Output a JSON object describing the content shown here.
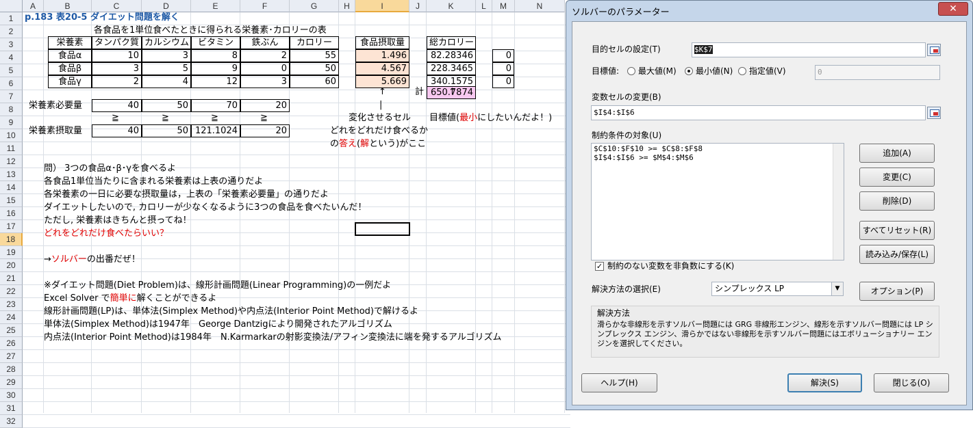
{
  "sheet": {
    "columns": [
      "A",
      "B",
      "C",
      "D",
      "E",
      "F",
      "G",
      "H",
      "I",
      "J",
      "K",
      "L",
      "M",
      "N"
    ],
    "rows": [
      "1",
      "2",
      "3",
      "4",
      "5",
      "6",
      "7",
      "8",
      "9",
      "10",
      "11",
      "12",
      "13",
      "14",
      "15",
      "16",
      "17",
      "18",
      "19",
      "20",
      "21",
      "22",
      "23",
      "24",
      "25",
      "26",
      "27",
      "28",
      "29",
      "30",
      "31",
      "32"
    ],
    "title": "p.183 表20-5 ダイエット問題を解く",
    "subtitle": "各食品を1単位食べたときに得られる栄養素･カロリーの表",
    "headers": [
      "栄養素",
      "タンパク質",
      "カルシウム",
      "ビタミン",
      "鉄ぶん",
      "カロリー"
    ],
    "foods": [
      {
        "name": "食品α",
        "values": [
          "10",
          "3",
          "8",
          "2",
          "55"
        ],
        "intake": "1.496",
        "cal": "82.28346",
        "m": "0"
      },
      {
        "name": "食品β",
        "values": [
          "3",
          "5",
          "9",
          "0",
          "50"
        ],
        "intake": "4.567",
        "cal": "228.3465",
        "m": "0"
      },
      {
        "name": "食品γ",
        "values": [
          "2",
          "4",
          "12",
          "3",
          "60"
        ],
        "intake": "5.669",
        "cal": "340.1575",
        "m": "0"
      }
    ],
    "intake_header": "食品摂取量",
    "cal_header": "総カロリー",
    "total_label": "計",
    "total_value": "650.7874",
    "required_label": "栄養素必要量",
    "required": [
      "40",
      "50",
      "70",
      "20"
    ],
    "ge": "≧",
    "taken_label": "栄養素摂取量",
    "taken": [
      "40",
      "50",
      "121.1024",
      "20"
    ],
    "arrow_up": "↑",
    "bar": "|",
    "change_label": "変化させるセル",
    "target_pre": "目標値(",
    "target_red": "最小",
    "target_post": "にしたいんだよ！)",
    "how_much": "どれをどれだけ食べるか",
    "answer_pre": "の",
    "answer_red1": "答え",
    "answer_mid": "(",
    "answer_red2": "解",
    "answer_post": "という)がここ",
    "q1": "問） 3つの食品α･β･γを食べるよ",
    "q2": "各食品1単位当たりに含まれる栄養素は上表の通りだよ",
    "q3": "各栄養素の一日に必要な摂取量は，上表の「栄養素必要量」の通りだよ",
    "q4": "ダイエットしたいので, カロリーが少なくなるように3つの食品を食べたいんだ！",
    "q5": "ただし, 栄養素はきちんと摂ってね！",
    "q6": "どれをどれだけ食べたらいい？",
    "s_pre": "→",
    "s_red": "ソルバー",
    "s_post": "の出番だぜ！",
    "n1": "※ダイエット問題(Diet Problem)は、線形計画問題(Linear Programming)の一例だよ",
    "n2_pre": "Excel Solver で",
    "n2_red": "簡単に",
    "n2_post": "解くことができるよ",
    "n3": "線形計画問題(LP)は、単体法(Simplex Method)や内点法(Interior Point Method)で解けるよ",
    "n4": "単体法(Simplex Method)は1947年　George Dantzigにより開発されたアルゴリズム",
    "n5": "内点法(Interior Point Method)は1984年　N.Karmarkarの射影変換法/アフィン変換法に端を発するアルゴリズム"
  },
  "dialog": {
    "title": "ソルバーのパラメーター",
    "close": "✕",
    "objective_label": "目的セルの設定(T)",
    "objective_value": "$K$7",
    "goal_label": "目標値:",
    "opt_max": "最大値(M)",
    "opt_min": "最小値(N)",
    "opt_value": "指定値(V)",
    "value_field": "0",
    "vars_label": "変数セルの変更(B)",
    "vars_value": "$I$4:$I$6",
    "constraints_label": "制約条件の対象(U)",
    "constraints": [
      "$C$10:$F$10 >= $C$8:$F$8",
      "$I$4:$I$6 >= $M$4:$M$6"
    ],
    "btn_add": "追加(A)",
    "btn_change": "変更(C)",
    "btn_delete": "削除(D)",
    "btn_reset": "すべてリセット(R)",
    "btn_load": "読み込み/保存(L)",
    "nonneg_label": "制約のない変数を非負数にする(K)",
    "method_label": "解決方法の選択(E)",
    "method_value": "シンプレックス LP",
    "btn_options": "オプション(P)",
    "method_group": "解決方法",
    "method_desc": "滑らかな非線形を示すソルバー問題には GRG 非線形エンジン、線形を示すソルバー問題には LP シンプレックス エンジン、滑らかではない非線形を示すソルバー問題にはエボリューショナリー エンジンを選択してください。",
    "btn_help": "ヘルプ(H)",
    "btn_solve": "解決(S)",
    "btn_close": "閉じる(O)"
  }
}
